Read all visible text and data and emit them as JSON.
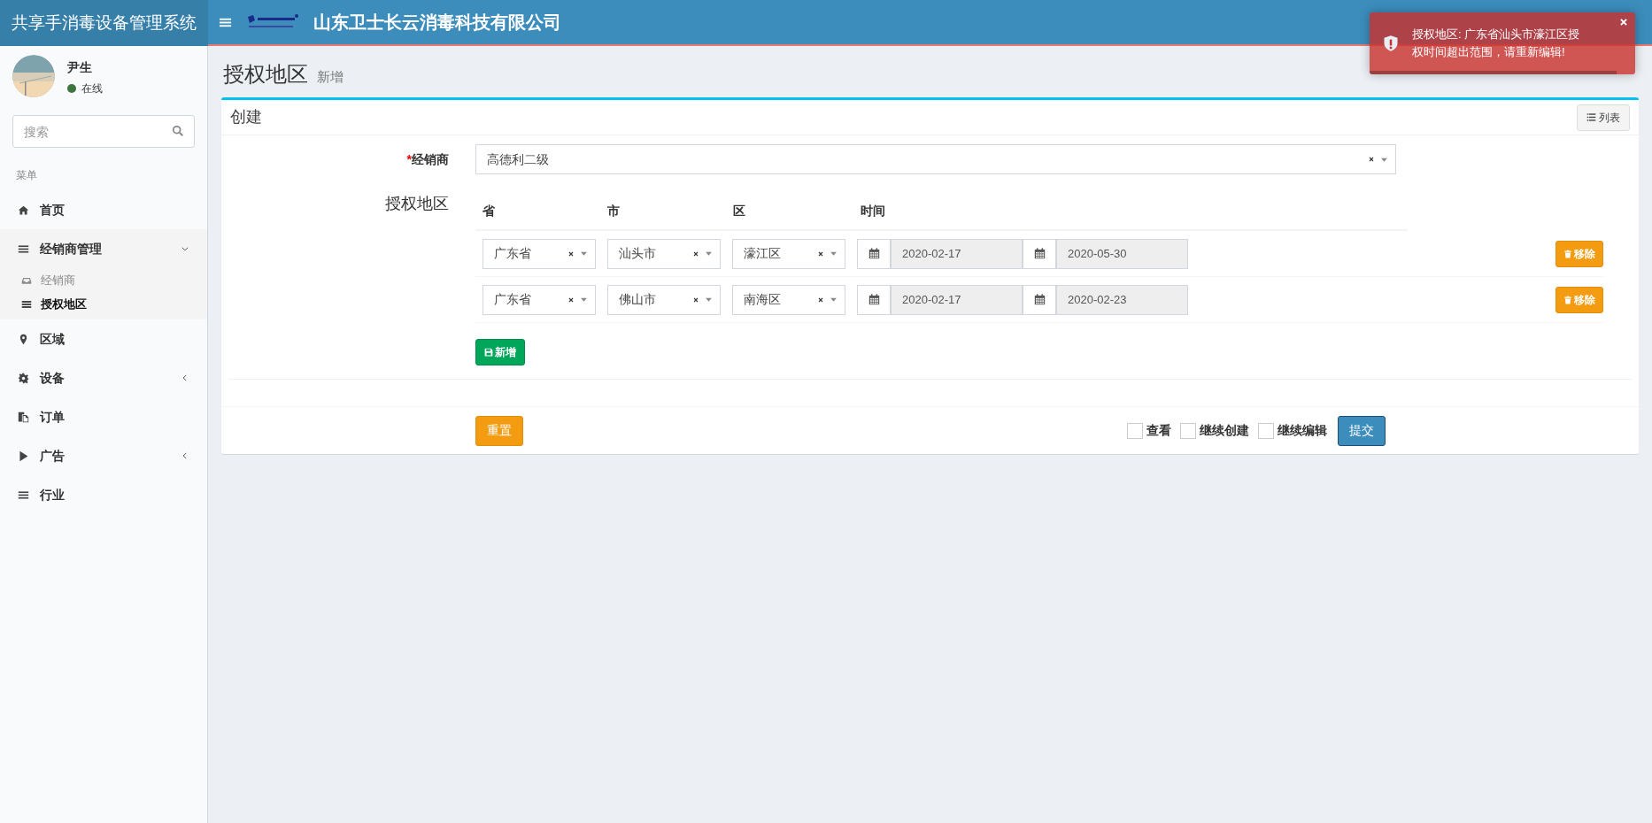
{
  "app_title": "共享手消毒设备管理系统",
  "company": "山东卫士长云消毒科技有限公司",
  "user": {
    "name": "尹生",
    "status": "在线"
  },
  "search": {
    "placeholder": "搜索"
  },
  "menu_header": "菜单",
  "menu": [
    {
      "label": "首页",
      "kind": "home",
      "has_children": false
    },
    {
      "label": "经销商管理",
      "kind": "bars",
      "expanded": true,
      "has_children": true,
      "children": [
        {
          "label": "经销商",
          "kind": "inbox",
          "selected": false
        },
        {
          "label": "授权地区",
          "kind": "bars",
          "selected": true
        }
      ]
    },
    {
      "label": "区域",
      "kind": "pin",
      "has_children": false
    },
    {
      "label": "设备",
      "kind": "gear",
      "expanded": false,
      "has_children": true
    },
    {
      "label": "订单",
      "kind": "copy",
      "has_children": false
    },
    {
      "label": "广告",
      "kind": "play",
      "expanded": false,
      "has_children": true
    },
    {
      "label": "行业",
      "kind": "bars",
      "has_children": false
    }
  ],
  "page": {
    "title": "授权地区",
    "subtitle": "新增"
  },
  "box": {
    "title": "创建",
    "list_button": "列表"
  },
  "dealer": {
    "required_mark": "*",
    "label": "经销商",
    "value": "高德利二级"
  },
  "region_label": "授权地区",
  "columns": [
    "省",
    "市",
    "区",
    "时间"
  ],
  "rows": [
    {
      "province": "广东省",
      "city": "汕头市",
      "district": "濠江区",
      "start": "2020-02-17",
      "end": "2020-05-30",
      "remove": "移除"
    },
    {
      "province": "广东省",
      "city": "佛山市",
      "district": "南海区",
      "start": "2020-02-17",
      "end": "2020-02-23",
      "remove": "移除"
    }
  ],
  "add_button": "新增",
  "reset_button": "重置",
  "options": [
    {
      "label": "查看",
      "checked": false
    },
    {
      "label": "继续创建",
      "checked": false
    },
    {
      "label": "继续编辑",
      "checked": false
    }
  ],
  "submit_button": "提交",
  "toast": {
    "message": "授权地区: 广东省汕头市濠江区授权时间超出范围，请重新编辑!",
    "level": 0.93
  }
}
